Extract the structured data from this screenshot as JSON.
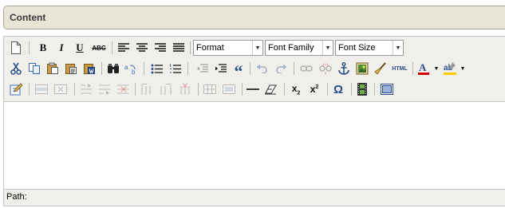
{
  "panel": {
    "title": "Content"
  },
  "toolbar": {
    "format_label": "Format",
    "font_family_label": "Font Family",
    "font_size_label": "Font Size",
    "bold_glyph": "B",
    "italic_glyph": "I",
    "underline_glyph": "U",
    "strike_glyph": "ABC",
    "html_label": "HTML",
    "subscript_glyph": "x",
    "superscript_glyph": "x",
    "sub_mark": "2",
    "sup_mark": "2",
    "omega_glyph": "Ω",
    "blockquote_glyph": "“",
    "font_color_glyph": "A",
    "highlight_glyph": "ab"
  },
  "statusbar": {
    "path_label": "Path:"
  },
  "colors": {
    "header_bg": "#e8e5d6",
    "toolbar_bg": "#f0efeb",
    "font_color_underline": "#d00000",
    "highlight_underline": "#ffcc00"
  }
}
